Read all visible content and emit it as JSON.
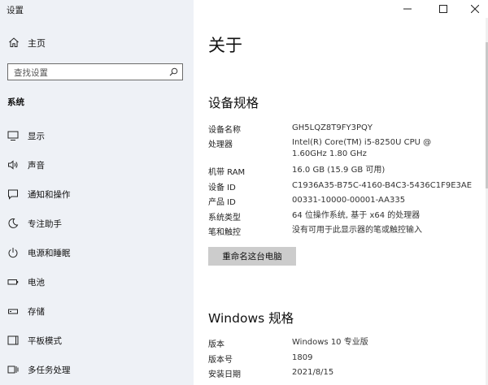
{
  "window": {
    "title": "设置"
  },
  "sidebar": {
    "home_label": "主页",
    "search_placeholder": "查找设置",
    "section_title": "系统",
    "items": [
      {
        "label": "显示",
        "icon": "monitor-icon"
      },
      {
        "label": "声音",
        "icon": "speaker-icon"
      },
      {
        "label": "通知和操作",
        "icon": "notification-icon"
      },
      {
        "label": "专注助手",
        "icon": "moon-icon"
      },
      {
        "label": "电源和睡眠",
        "icon": "power-icon"
      },
      {
        "label": "电池",
        "icon": "battery-icon"
      },
      {
        "label": "存储",
        "icon": "storage-icon"
      },
      {
        "label": "平板模式",
        "icon": "tablet-icon"
      },
      {
        "label": "多任务处理",
        "icon": "multitask-icon"
      }
    ]
  },
  "main": {
    "title": "关于",
    "device_specs": {
      "heading": "设备规格",
      "rows": [
        {
          "label": "设备名称",
          "value": "GH5LQZ8T9FY3PQY"
        },
        {
          "label": "处理器",
          "value": "Intel(R) Core(TM) i5-8250U CPU @ 1.60GHz 1.80 GHz"
        },
        {
          "label": "机带 RAM",
          "value": "16.0 GB (15.9 GB 可用)"
        },
        {
          "label": "设备 ID",
          "value": "C1936A35-B75C-4160-B4C3-5436C1F9E3AE"
        },
        {
          "label": "产品 ID",
          "value": "00331-10000-00001-AA335"
        },
        {
          "label": "系统类型",
          "value": "64 位操作系统, 基于 x64 的处理器"
        },
        {
          "label": "笔和触控",
          "value": "没有可用于此显示器的笔或触控输入"
        }
      ],
      "rename_button": "重命名这台电脑"
    },
    "windows_specs": {
      "heading": "Windows 规格",
      "rows": [
        {
          "label": "版本",
          "value": "Windows 10 专业版"
        },
        {
          "label": "版本号",
          "value": "1809"
        },
        {
          "label": "安装日期",
          "value": "2021/8/15"
        }
      ]
    }
  },
  "colors": {
    "sidebar_bg": "#eef1f6",
    "button_bg": "#cccccc"
  }
}
